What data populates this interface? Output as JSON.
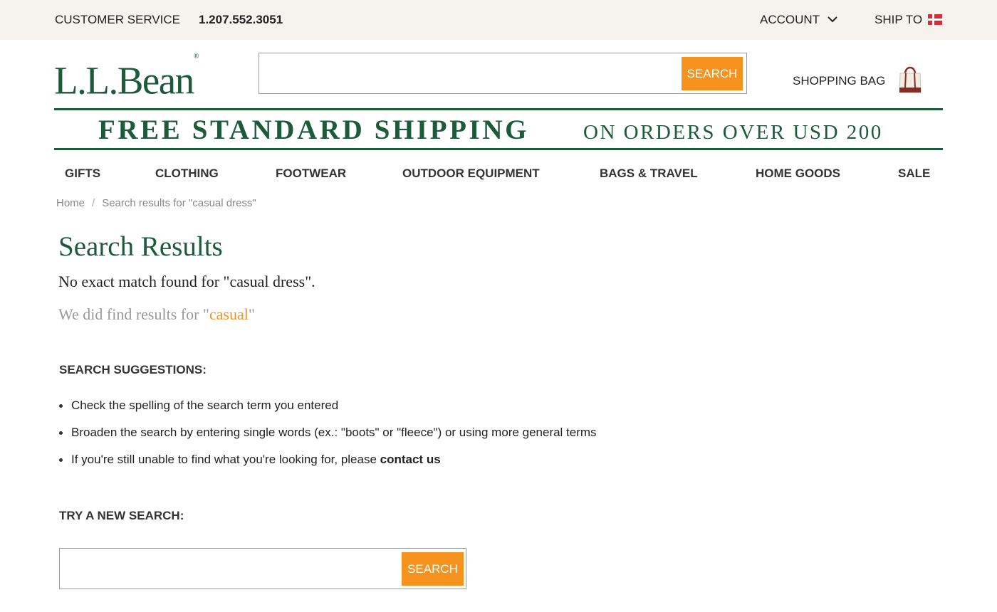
{
  "topbar": {
    "customer_service": "CUSTOMER SERVICE",
    "phone": "1.207.552.3051",
    "account": "ACCOUNT",
    "ship_to": "SHIP TO"
  },
  "header": {
    "logo_text": "L.L.Bean",
    "logo_mark": "®",
    "search_placeholder": "",
    "search_value": "",
    "search_button": "SEARCH",
    "shopping_bag": "SHOPPING BAG"
  },
  "promo": {
    "big": "FREE STANDARD SHIPPING",
    "small": "ON ORDERS OVER USD 200"
  },
  "nav": {
    "items": [
      "GIFTS",
      "CLOTHING",
      "FOOTWEAR",
      "OUTDOOR EQUIPMENT",
      "BAGS & TRAVEL",
      "HOME GOODS",
      "SALE"
    ]
  },
  "breadcrumb": {
    "home": "Home",
    "separator": "/",
    "current": "Search results for \"casual dress\""
  },
  "results": {
    "title": "Search Results",
    "no_match": "No exact match found for \"casual dress\".",
    "did_find_prefix": "We did find results for \"",
    "did_find_term": "casual",
    "did_find_suffix": "\""
  },
  "suggestions": {
    "heading": "SEARCH SUGGESTIONS:",
    "items": [
      "Check the spelling of the search term you entered",
      "Broaden the search by entering single words (ex.: \"boots\" or \"fleece\") or using more general terms"
    ],
    "contact_prefix": "If you're still unable to find what you're looking for, please ",
    "contact_link": "contact us"
  },
  "try_again": {
    "heading": "TRY A NEW SEARCH:",
    "search_value": "",
    "search_button": "SEARCH"
  },
  "colors": {
    "brand_green": "#1d5a3a",
    "accent_orange": "#f6921e",
    "topbar_bg": "#f6f3ee"
  },
  "icons": [
    "chevron-down-icon",
    "denmark-flag-icon",
    "tote-bag-icon",
    "bullet-icon"
  ]
}
